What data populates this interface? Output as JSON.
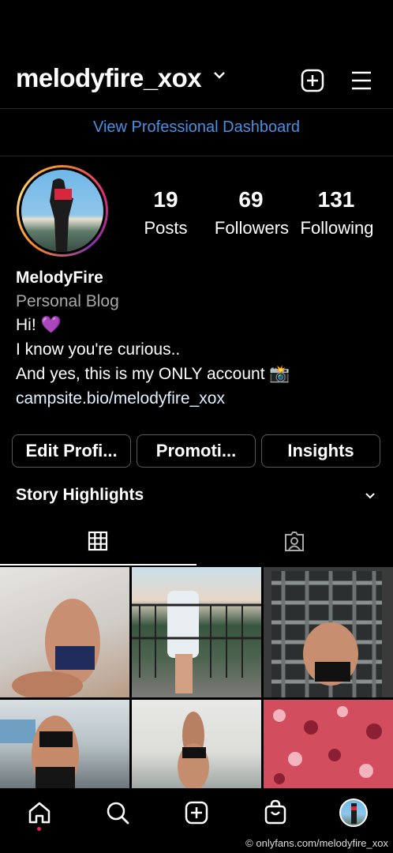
{
  "header": {
    "username": "melodyfire_xox"
  },
  "dashboard_link": "View Professional Dashboard",
  "profile": {
    "stats": [
      {
        "value": "19",
        "label": "Posts"
      },
      {
        "value": "69",
        "label": "Followers"
      },
      {
        "value": "131",
        "label": "Following"
      }
    ],
    "name": "MelodyFire",
    "category": "Personal Blog",
    "bio": [
      "Hi! 💜",
      "I know you're curious..",
      "And yes, this is my ONLY account 📸"
    ],
    "link": "campsite.bio/melodyfire_xox"
  },
  "buttons": {
    "edit": "Edit Profi...",
    "promotions": "Promoti...",
    "insights": "Insights"
  },
  "story_highlights": "Story Highlights",
  "watermark": "© onlyfans.com/melodyfire_xox",
  "colors": {
    "link_blue": "#4a90e2",
    "background": "#000000",
    "notification_dot": "#e0245e"
  }
}
